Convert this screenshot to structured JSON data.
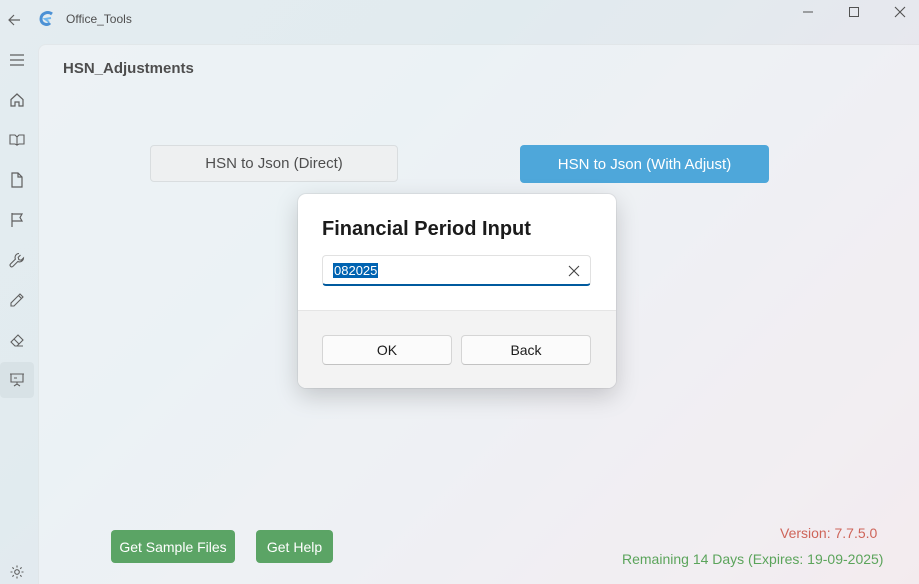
{
  "app": {
    "title": "Office_Tools"
  },
  "nav": {
    "items": [
      "menu-icon",
      "home-icon",
      "book-icon",
      "document-icon",
      "flag-icon",
      "wrench-icon",
      "pencil-icon",
      "eraser-icon",
      "presentation-icon"
    ],
    "selected": "presentation-icon",
    "footer": "settings-icon"
  },
  "page": {
    "title": "HSN_Adjustments",
    "btn_direct": "HSN to Json (Direct)",
    "btn_adjust": "HSN to Json (With Adjust)",
    "btn_sample": "Get Sample Files",
    "btn_help": "Get Help",
    "version": "Version: 7.7.5.0",
    "remaining": "Remaining 14 Days (Expires: 19-09-2025)"
  },
  "dialog": {
    "title": "Financial Period Input",
    "input_value": "082025",
    "ok_label": "OK",
    "back_label": "Back"
  },
  "colors": {
    "accent": "#1d8fd0",
    "green_button": "#2e8b3a",
    "version_text": "#c0392b",
    "remaining_text": "#2e8b2e",
    "selection": "#0063b1"
  }
}
